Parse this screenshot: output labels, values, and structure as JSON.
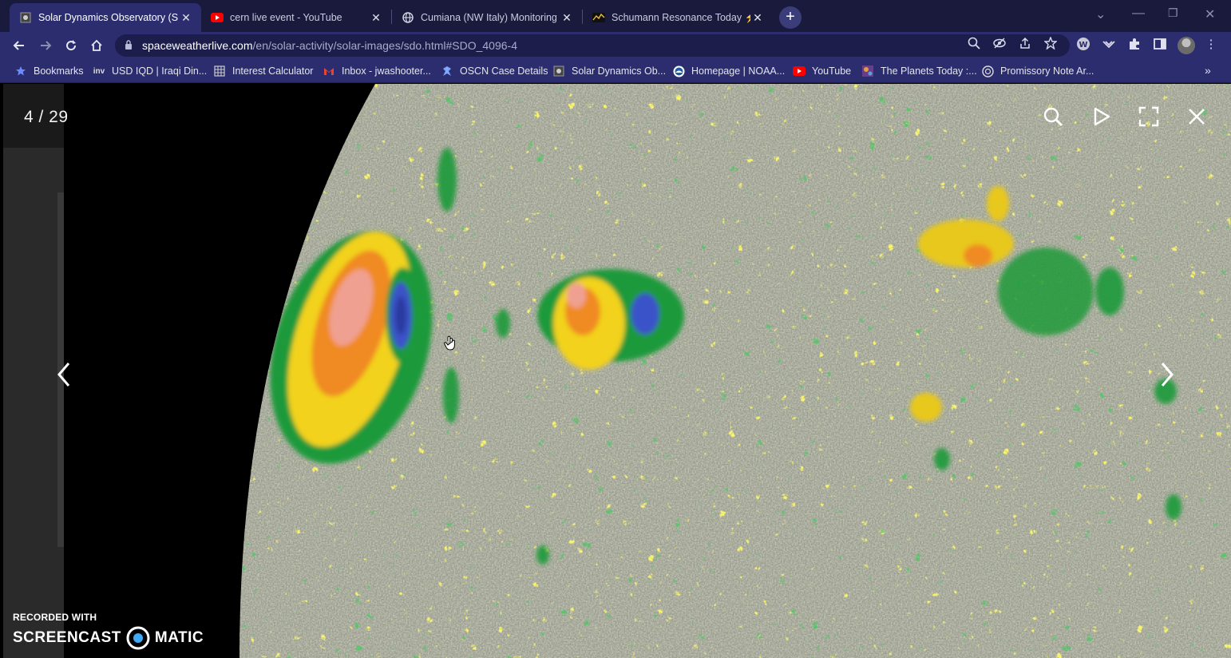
{
  "tabs": [
    {
      "title": "Solar Dynamics Observatory (SDO",
      "favicon": "spaceweather-icon",
      "active": true
    },
    {
      "title": "cern live event - YouTube",
      "favicon": "youtube-icon",
      "active": false
    },
    {
      "title": "Cumiana (NW Italy) Monitoring S",
      "favicon": "globe-icon",
      "active": false
    },
    {
      "title": "Schumann Resonance Today ⚡",
      "favicon": "schumann-icon",
      "active": false
    }
  ],
  "address_bar": {
    "host": "spaceweatherlive.com",
    "path": "/en/solar-activity/solar-images/sdo.html#SDO_4096-4"
  },
  "bookmarks": [
    {
      "label": "Bookmarks",
      "icon": "star-icon"
    },
    {
      "label": "USD IQD | Iraqi Din...",
      "icon": "inv-icon"
    },
    {
      "label": "Interest Calculator",
      "icon": "calculator-icon"
    },
    {
      "label": "Inbox - jwashooter...",
      "icon": "gmail-icon"
    },
    {
      "label": "OSCN Case Details",
      "icon": "oscn-icon"
    },
    {
      "label": "Solar Dynamics Ob...",
      "icon": "spaceweather-icon"
    },
    {
      "label": "Homepage | NOAA...",
      "icon": "noaa-icon"
    },
    {
      "label": "YouTube",
      "icon": "youtube-icon"
    },
    {
      "label": "The Planets Today :...",
      "icon": "planets-icon"
    },
    {
      "label": "Promissory Note Ar...",
      "icon": "promissory-icon"
    }
  ],
  "viewer": {
    "counter": "4 / 29"
  },
  "watermark": {
    "line1": "RECORDED WITH",
    "brand_left": "SCREENCAST",
    "brand_right": "MATIC"
  },
  "colors": {
    "tab_strip": "#1a1b3c",
    "toolbar": "#2b2d6e",
    "omnibox": "#1c1d4a",
    "sun_base": "#9a9d8e"
  }
}
